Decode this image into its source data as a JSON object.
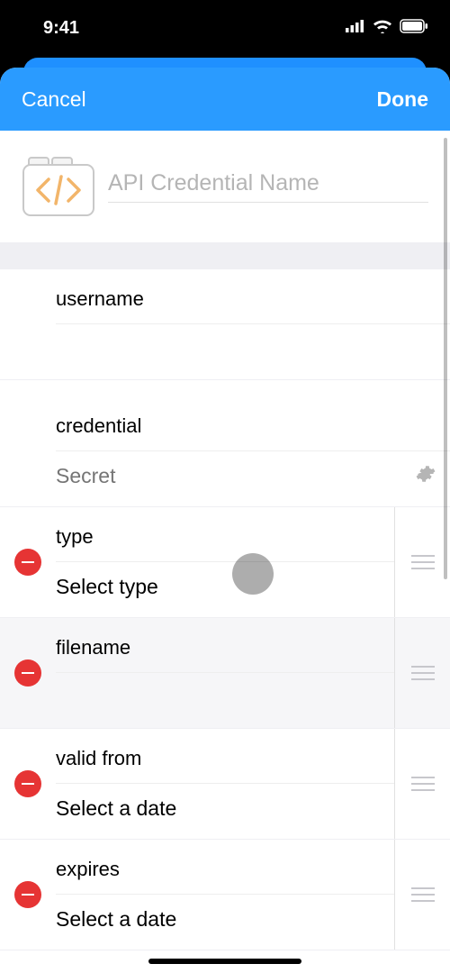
{
  "status": {
    "time": "9:41"
  },
  "nav": {
    "cancel": "Cancel",
    "done": "Done"
  },
  "title": {
    "placeholder": "API Credential Name",
    "value": ""
  },
  "fields": {
    "username": {
      "label": "username",
      "value": ""
    },
    "credential": {
      "label": "credential",
      "placeholder": "Secret",
      "value": ""
    },
    "type": {
      "label": "type",
      "value": "Select type"
    },
    "filename": {
      "label": "filename",
      "value": ""
    },
    "valid_from": {
      "label": "valid from",
      "value": "Select a date"
    },
    "expires": {
      "label": "expires",
      "value": "Select a date"
    }
  }
}
